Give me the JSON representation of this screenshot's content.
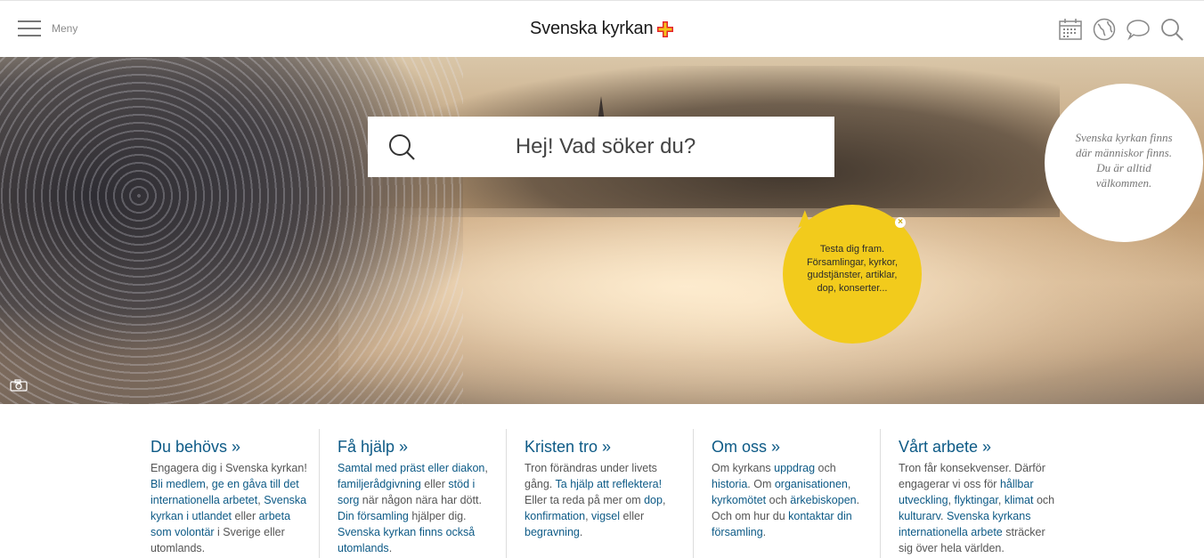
{
  "header": {
    "menu_label": "Meny",
    "logo_text": "Svenska kyrkan",
    "icons": [
      "calendar-icon",
      "globe-icon",
      "chat-icon",
      "search-icon"
    ]
  },
  "hero": {
    "search_placeholder": "Hej! Vad söker du?",
    "tip_text": "Testa dig fram. Församlingar, kyrkor, gudstjänster, artiklar, dop, konserter...",
    "tip_close": "×",
    "welcome_text": "Svenska kyrkan finns där människor finns. Du är alltid välkommen."
  },
  "columns": [
    {
      "title": "Du behövs »",
      "parts": [
        {
          "t": "Engagera dig i Svenska kyrkan! "
        },
        {
          "t": "Bli medlem",
          "link": true
        },
        {
          "t": ", "
        },
        {
          "t": "ge en gåva till det internationella arbetet",
          "link": true
        },
        {
          "t": ", "
        },
        {
          "t": "Svenska kyrkan i utlandet",
          "link": true
        },
        {
          "t": " eller "
        },
        {
          "t": "arbeta som volontär",
          "link": true
        },
        {
          "t": " i Sverige eller utomlands."
        }
      ]
    },
    {
      "title": "Få hjälp »",
      "parts": [
        {
          "t": "Samtal med präst eller diakon",
          "link": true
        },
        {
          "t": ", "
        },
        {
          "t": "familjerådgivning",
          "link": true
        },
        {
          "t": " eller "
        },
        {
          "t": "stöd i sorg",
          "link": true
        },
        {
          "t": " när någon nära har dött. "
        },
        {
          "t": "Din församling",
          "link": true
        },
        {
          "t": " hjälper dig. "
        },
        {
          "t": "Svenska kyrkan finns också",
          "link": true
        },
        {
          "t": " "
        },
        {
          "t": "utomlands",
          "link": true
        },
        {
          "t": "."
        }
      ]
    },
    {
      "title": "Kristen tro »",
      "parts": [
        {
          "t": "Tron förändras under livets gång. "
        },
        {
          "t": "Ta hjälp att reflektera!",
          "link": true
        },
        {
          "t": " Eller ta reda på mer om "
        },
        {
          "t": "dop",
          "link": true
        },
        {
          "t": ", "
        },
        {
          "t": "konfirmation",
          "link": true
        },
        {
          "t": ", "
        },
        {
          "t": "vigsel",
          "link": true
        },
        {
          "t": " eller "
        },
        {
          "t": "begravning",
          "link": true
        },
        {
          "t": "."
        }
      ]
    },
    {
      "title": "Om oss »",
      "parts": [
        {
          "t": "Om kyrkans "
        },
        {
          "t": "uppdrag",
          "link": true
        },
        {
          "t": " och "
        },
        {
          "t": "historia",
          "link": true
        },
        {
          "t": ". Om "
        },
        {
          "t": "organisationen",
          "link": true
        },
        {
          "t": ", "
        },
        {
          "t": "kyrkomötet",
          "link": true
        },
        {
          "t": " och "
        },
        {
          "t": "ärkebiskopen",
          "link": true
        },
        {
          "t": ". Och om hur du "
        },
        {
          "t": "kontaktar din församling",
          "link": true
        },
        {
          "t": "."
        }
      ]
    },
    {
      "title": "Vårt arbete »",
      "parts": [
        {
          "t": "Tron får konsekvenser. Därför engagerar vi oss för "
        },
        {
          "t": "hållbar utveckling",
          "link": true
        },
        {
          "t": ", "
        },
        {
          "t": "flyktingar",
          "link": true
        },
        {
          "t": ", "
        },
        {
          "t": "klimat",
          "link": true
        },
        {
          "t": " och "
        },
        {
          "t": "kulturarv",
          "link": true
        },
        {
          "t": ". "
        },
        {
          "t": "Svenska kyrkans internationella arbete",
          "link": true
        },
        {
          "t": " sträcker sig över hela världen."
        }
      ]
    }
  ]
}
